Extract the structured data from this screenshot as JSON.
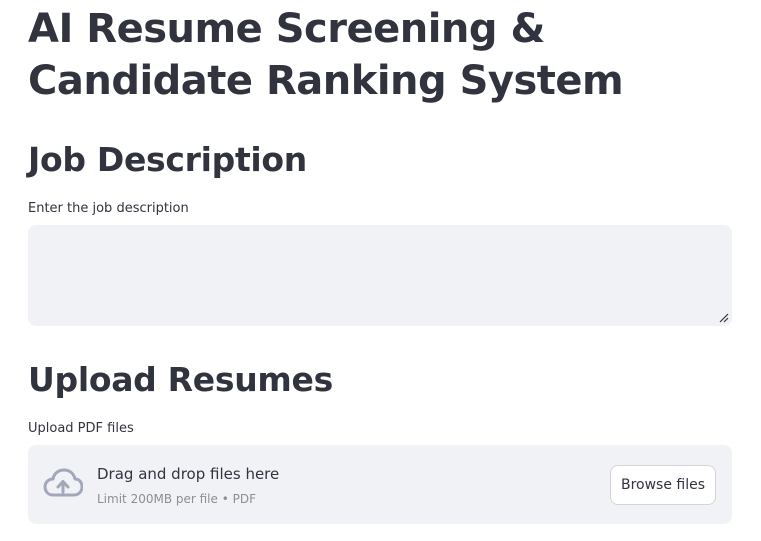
{
  "page": {
    "title": "AI Resume Screening & Candidate Ranking System"
  },
  "job_section": {
    "heading": "Job Description",
    "label": "Enter the job description",
    "value": ""
  },
  "upload_section": {
    "heading": "Upload Resumes",
    "label": "Upload PDF files",
    "dropzone": {
      "icon": "cloud-upload-icon",
      "instruction": "Drag and drop files here",
      "limit_text": "Limit 200MB per file • PDF",
      "button_label": "Browse files"
    }
  },
  "colors": {
    "text": "#31333f",
    "input_bg": "#f0f2f6",
    "muted_text": "#8c8e96",
    "icon": "#a3a8b8"
  }
}
